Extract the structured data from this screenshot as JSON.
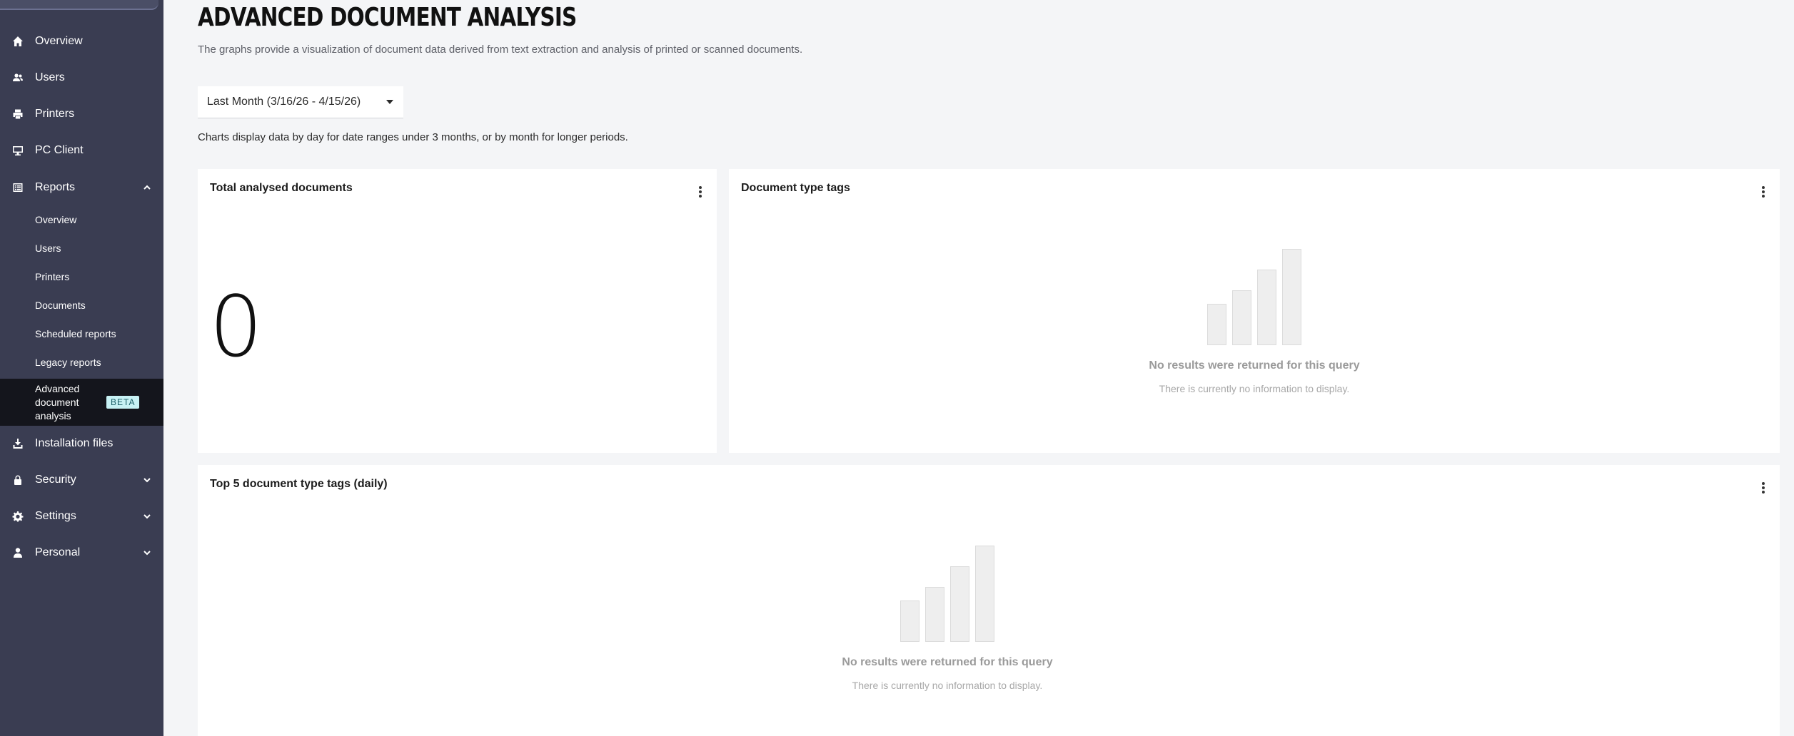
{
  "sidebar": {
    "items": [
      {
        "label": "Overview",
        "icon": "home-icon"
      },
      {
        "label": "Users",
        "icon": "users-icon"
      },
      {
        "label": "Printers",
        "icon": "printer-icon"
      },
      {
        "label": "PC Client",
        "icon": "monitor-icon"
      },
      {
        "label": "Reports",
        "icon": "reports-icon",
        "expanded": true
      },
      {
        "label": "Installation files",
        "icon": "download-icon"
      },
      {
        "label": "Security",
        "icon": "lock-icon",
        "expanded": false
      },
      {
        "label": "Settings",
        "icon": "gear-icon",
        "expanded": false
      },
      {
        "label": "Personal",
        "icon": "person-icon",
        "expanded": false
      }
    ],
    "reports_sub": [
      {
        "label": "Overview"
      },
      {
        "label": "Users"
      },
      {
        "label": "Printers"
      },
      {
        "label": "Documents"
      },
      {
        "label": "Scheduled reports"
      },
      {
        "label": "Legacy reports"
      },
      {
        "label": "Advanced document analysis",
        "active": true,
        "badge": "BETA"
      }
    ],
    "background_color": "#3a3d52",
    "active_color": "#14151c",
    "badge_color": "#c7f1f4"
  },
  "page": {
    "title": "ADVANCED DOCUMENT ANALYSIS",
    "description": "The graphs provide a visualization of document data derived from text extraction and analysis of printed or scanned documents.",
    "range_selected": "Last Month (3/16/26 - 4/15/26)",
    "range_note": "Charts display data by day for date ranges under 3 months, or by month for longer periods."
  },
  "cards": {
    "total": {
      "title": "Total analysed documents",
      "value": "0"
    },
    "doc_types": {
      "title": "Document type tags",
      "empty_title": "No results were returned for this query",
      "empty_sub": "There is currently no information to display."
    },
    "top5": {
      "title": "Top 5 document type tags (daily)",
      "empty_title": "No results were returned for this query",
      "empty_sub": "There is currently no information to display."
    }
  }
}
